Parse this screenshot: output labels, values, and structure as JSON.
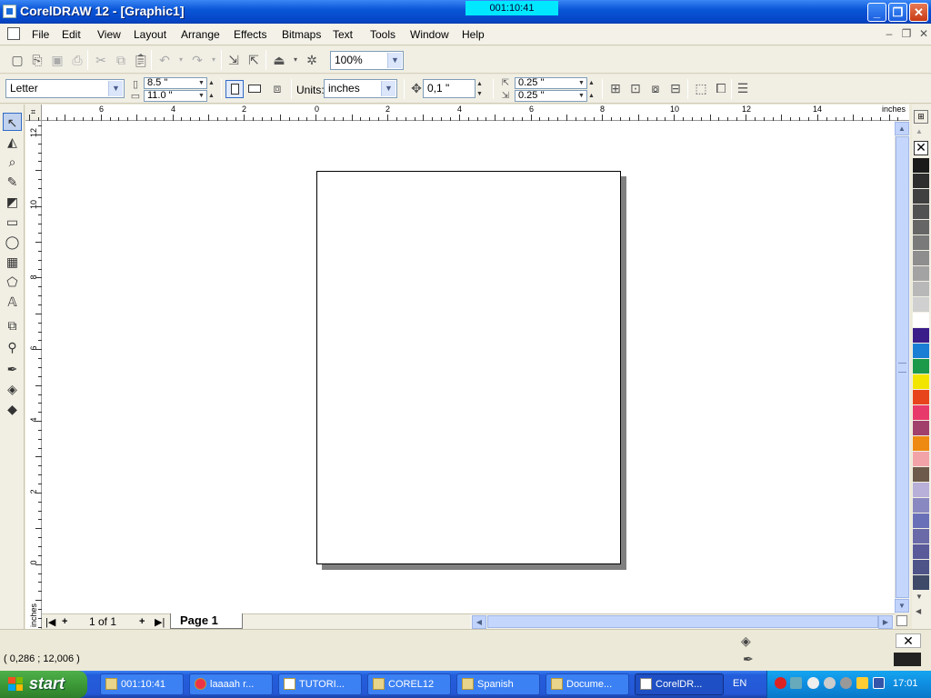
{
  "window": {
    "title": "CorelDRAW 12 - [Graphic1]",
    "timer": "001:10:41",
    "controls": [
      "minimize",
      "maximize",
      "close"
    ]
  },
  "menu": {
    "items": [
      "File",
      "Edit",
      "View",
      "Layout",
      "Arrange",
      "Effects",
      "Bitmaps",
      "Text",
      "Tools",
      "Window",
      "Help"
    ]
  },
  "standard_toolbar": {
    "zoom_value": "100%"
  },
  "property_bar": {
    "paper_type": "Letter",
    "width": "8.5 \"",
    "height": "11.0 \"",
    "units_label": "Units:",
    "units_value": "inches",
    "nudge": "0,1 \"",
    "dup_x": "0.25 \"",
    "dup_y": "0.25 \""
  },
  "rulers": {
    "h_numbers": [
      "6",
      "4",
      "2",
      "0",
      "2",
      "4",
      "6",
      "8",
      "10",
      "12",
      "14"
    ],
    "h_unit": "inches",
    "v_numbers": [
      "12",
      "10",
      "8",
      "6",
      "4",
      "2",
      "0"
    ],
    "v_unit": "inches"
  },
  "page_nav": {
    "counter": "1 of 1",
    "tab_label": "Page 1"
  },
  "palette": {
    "colors": [
      "#1a1a1a",
      "#2e2e2e",
      "#404040",
      "#525252",
      "#666666",
      "#7a7a7a",
      "#8e8e8e",
      "#a3a3a3",
      "#b8b8b8",
      "#d0d0d0",
      "#ffffff",
      "#3b1d8a",
      "#1a7fd4",
      "#1c9a4a",
      "#f2e600",
      "#e8441c",
      "#e83a6a",
      "#a2406c",
      "#ee8a12",
      "#f2a3a8",
      "#6e5a4a",
      "#b8b0d8",
      "#8a88c0",
      "#6a70b8",
      "#6a6aa8",
      "#5a5a9a",
      "#4e5488",
      "#3e4a68"
    ]
  },
  "status": {
    "coordinates": "( 0,286 ; 12,006 )"
  },
  "taskbar": {
    "start_label": "start",
    "tasks": [
      "001:10:41",
      "laaaah r...",
      "TUTORI...",
      "COREL12",
      "Spanish",
      "Docume...",
      "CorelDR..."
    ],
    "language": "EN",
    "clock": "17:01"
  }
}
